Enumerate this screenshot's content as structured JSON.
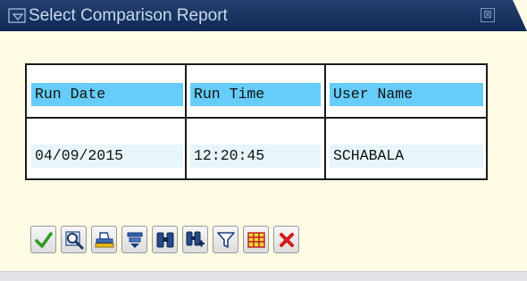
{
  "window": {
    "title": "Select Comparison Report",
    "close_glyph": "⊠"
  },
  "table": {
    "columns": [
      "Run Date",
      "Run Time",
      "User Name"
    ],
    "rows": [
      [
        "04/09/2015",
        "12:20:45",
        "SCHABALA"
      ]
    ]
  },
  "toolbar": {
    "buttons": [
      {
        "name": "continue-button",
        "icon": "checkmark-icon"
      },
      {
        "name": "details-button",
        "icon": "magnifier-icon"
      },
      {
        "name": "print-button",
        "icon": "printer-icon"
      },
      {
        "name": "sort-button",
        "icon": "sort-icon"
      },
      {
        "name": "find-button",
        "icon": "binoculars-icon"
      },
      {
        "name": "find-next-button",
        "icon": "binoculars-plus-icon"
      },
      {
        "name": "filter-button",
        "icon": "funnel-icon"
      },
      {
        "name": "layout-button",
        "icon": "grid-icon"
      },
      {
        "name": "cancel-button",
        "icon": "red-x-icon"
      }
    ]
  },
  "colors": {
    "title_bar": "#1b3462",
    "dialog_bg": "#fffbe4",
    "header_cell": "#66cdfb",
    "value_cell": "#e8f6fb"
  }
}
